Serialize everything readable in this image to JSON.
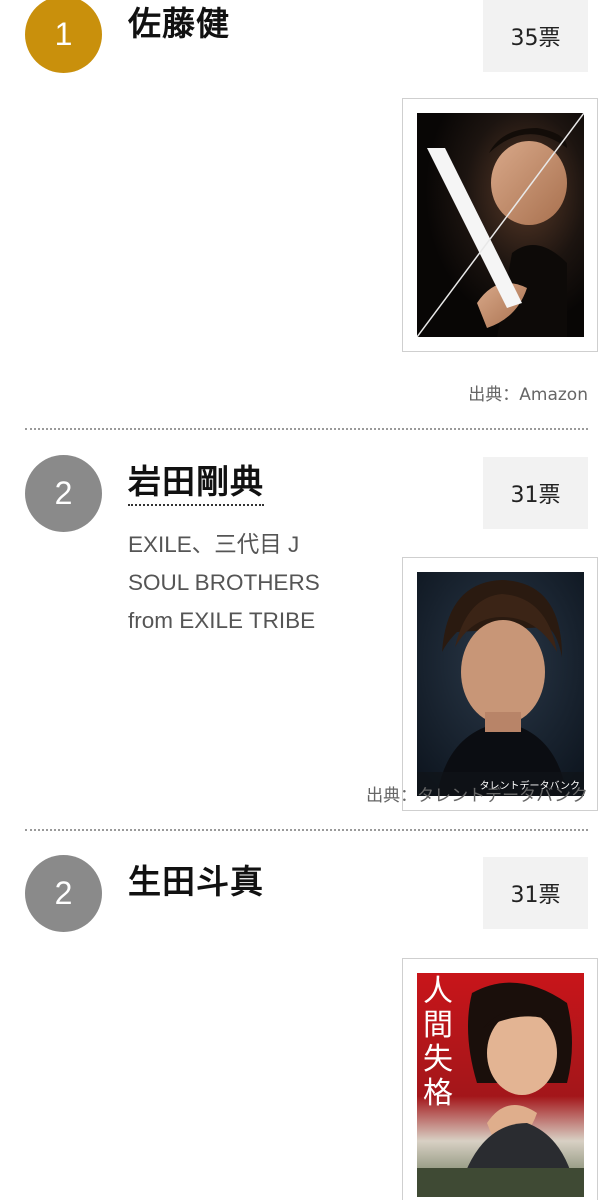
{
  "entries": [
    {
      "rank": "1",
      "name": "佐藤健",
      "votes": "35票",
      "group": "",
      "source": "出典：Amazon",
      "rank_color": "#c9900c"
    },
    {
      "rank": "2",
      "name": "岩田剛典",
      "votes": "31票",
      "group_lines": [
        "EXILE、三代目 J",
        "SOUL BROTHERS",
        "from EXILE TRIBE"
      ],
      "source": "出典：タレントデータバンク",
      "photo_caption": "タレントデータバンク",
      "rank_color": "#8a8a8a"
    },
    {
      "rank": "2",
      "name": "生田斗真",
      "votes": "31票",
      "group": "",
      "photo_title": [
        "人",
        "間",
        "失",
        "格"
      ],
      "rank_color": "#8a8a8a"
    }
  ]
}
